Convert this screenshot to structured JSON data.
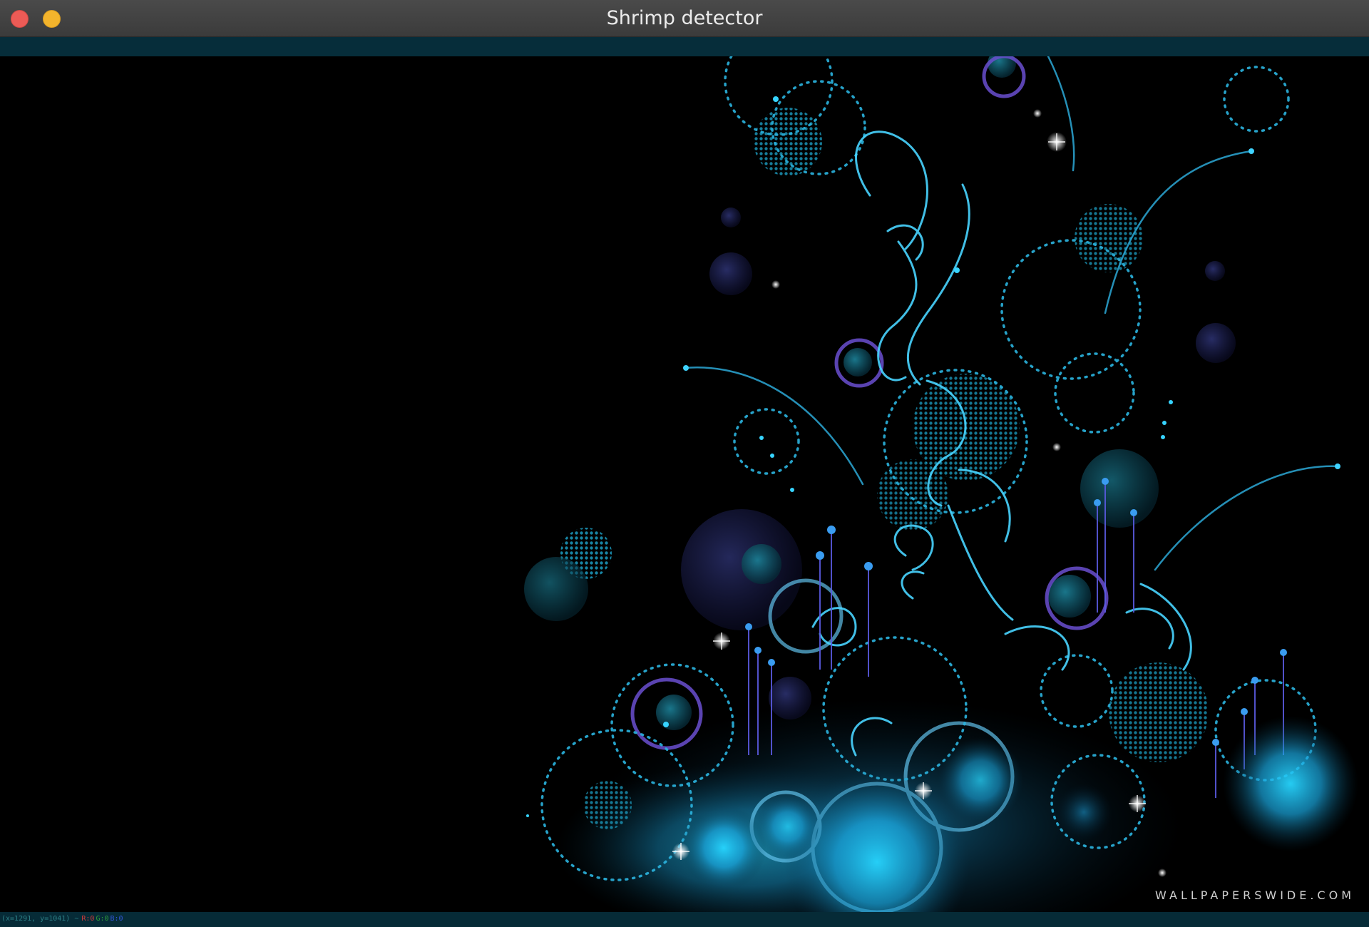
{
  "window": {
    "title": "Shrimp detector"
  },
  "icons": {
    "close": "close-traffic-light",
    "minimize": "minimize-traffic-light"
  },
  "colors": {
    "titlebar": "#3e3e3e",
    "toolbar": "#062d3a",
    "statusbar": "#062b37",
    "accent": "#1ec8ff",
    "background": "#000000"
  },
  "canvas": {
    "watermark": "WALLPAPERSWIDE.COM"
  },
  "status": {
    "coords": "(x=1291, y=1041) ~",
    "r": "R:0",
    "g": "G:0",
    "b": "B:0"
  }
}
